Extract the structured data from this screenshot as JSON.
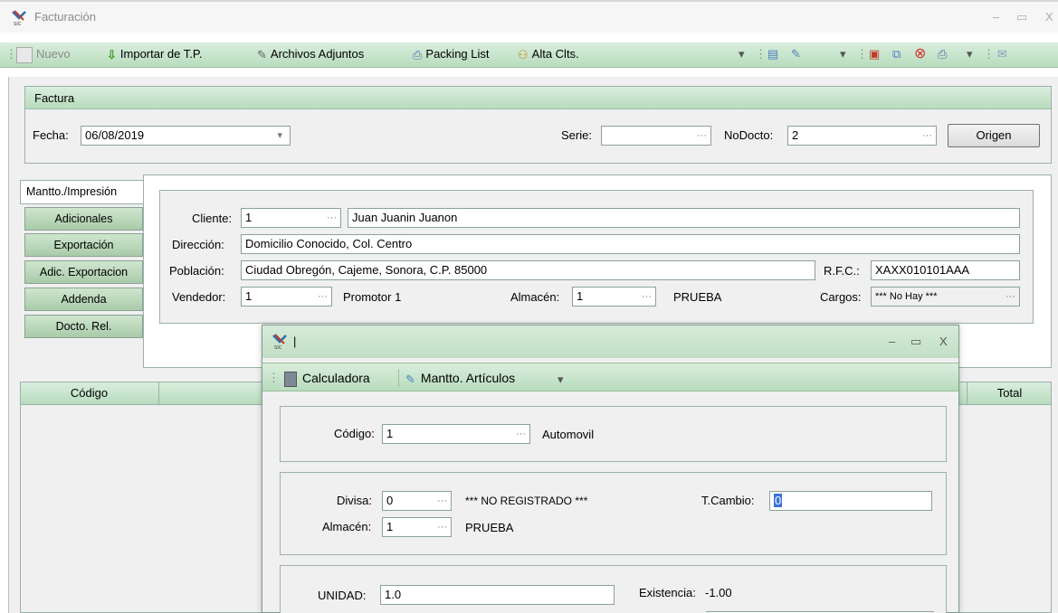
{
  "window": {
    "title": "Facturación",
    "minimize": "–",
    "maximize": "▭",
    "close": "X"
  },
  "toolbar": {
    "nuevo": "Nuevo",
    "importar": "Importar de T.P.",
    "archivos": "Archivos Adjuntos",
    "packing": "Packing List",
    "alta": "Alta Clts."
  },
  "factura": {
    "header": "Factura",
    "fecha_label": "Fecha:",
    "fecha_value": "06/08/2019",
    "serie_label": "Serie:",
    "serie_value": "",
    "nodocto_label": "NoDocto:",
    "nodocto_value": "2",
    "origen_button": "Origen"
  },
  "side_tabs": [
    "Mantto./Impresión",
    "Adicionales",
    "Exportación",
    "Adic. Exportacion",
    "Addenda",
    "Docto. Rel."
  ],
  "cliente": {
    "cliente_label": "Cliente:",
    "cliente_value": "1",
    "cliente_name": "Juan Juanin Juanon",
    "direccion_label": "Dirección:",
    "direccion_value": "Domicilio Conocido, Col. Centro",
    "poblacion_label": "Población:",
    "poblacion_value": "Ciudad Obregón, Cajeme, Sonora, C.P. 85000",
    "rfc_label": "R.F.C.:",
    "rfc_value": "XAXX010101AAA",
    "vendedor_label": "Vendedor:",
    "vendedor_value": "1",
    "vendedor_name": "Promotor 1",
    "almacen_label": "Almacén:",
    "almacen_value": "1",
    "almacen_name": "PRUEBA",
    "cargos_label": "Cargos:",
    "cargos_value": "*** No Hay ***"
  },
  "grid": {
    "col_codigo": "Código",
    "col_total": "Total"
  },
  "dialog": {
    "title": "|",
    "minimize": "–",
    "maximize": "▭",
    "close": "X",
    "calculadora": "Calculadora",
    "mantto_articulos": "Mantto. Artículos",
    "codigo_label": "Código:",
    "codigo_value": "1",
    "codigo_name": "Automovil",
    "divisa_label": "Divisa:",
    "divisa_value": "0",
    "divisa_name": "*** NO REGISTRADO ***",
    "tcambio_label": "T.Cambio:",
    "tcambio_value": "0",
    "almacen_label": "Almacén:",
    "almacen_value": "1",
    "almacen_name": "PRUEBA",
    "unidad_label": "UNIDAD:",
    "unidad_value": "1.0",
    "existencia_label": "Existencia:",
    "existencia_value": "-1.00"
  },
  "ellipsis": "···",
  "dropdown_arrow": "▾"
}
